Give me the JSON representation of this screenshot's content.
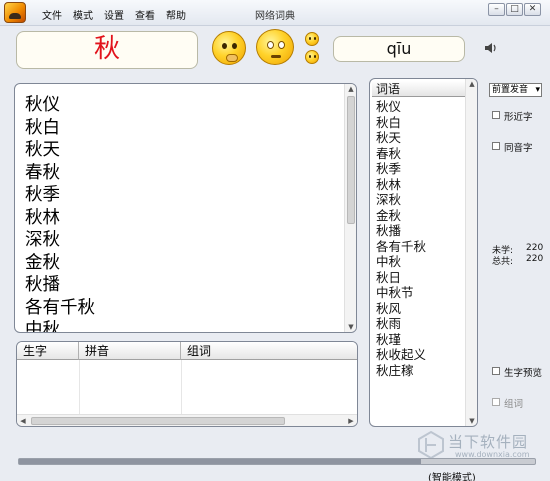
{
  "window": {
    "title": "网络词典",
    "controls": {
      "minimize": "–",
      "maximize": "□",
      "close": "✕"
    }
  },
  "menu": [
    "文件",
    "模式",
    "设置",
    "查看",
    "帮助"
  ],
  "current_char": "秋",
  "pinyin": "qīu",
  "big_list": [
    "秋仪",
    "秋白",
    "秋天",
    "春秋",
    "秋季",
    "秋林",
    "深秋",
    "金秋",
    "秋播",
    "各有千秋",
    "中秋"
  ],
  "table": {
    "columns": [
      "生字",
      "拼音",
      "组词"
    ],
    "rows": []
  },
  "words_panel": {
    "header": "词语",
    "items": [
      "秋仪",
      "秋白",
      "秋天",
      "春秋",
      "秋季",
      "秋林",
      "深秋",
      "金秋",
      "秋播",
      "各有千秋",
      "中秋",
      "秋日",
      "中秋节",
      "秋风",
      "秋雨",
      "秋瑾",
      "秋收起义",
      "秋庄稼"
    ]
  },
  "options": {
    "voice_select": "前置发音",
    "similar_shape": "形近字",
    "homophone": "同音字",
    "preview": "生字预览",
    "group_words": "组词"
  },
  "stats": {
    "unlearned_label": "未学:",
    "unlearned_value": "220",
    "total_label": "总共:",
    "total_value": "220"
  },
  "progress": 0.78,
  "mode": "(智能模式)",
  "watermark": {
    "title": "当下软件园",
    "subtitle": "www.downxia.com"
  }
}
